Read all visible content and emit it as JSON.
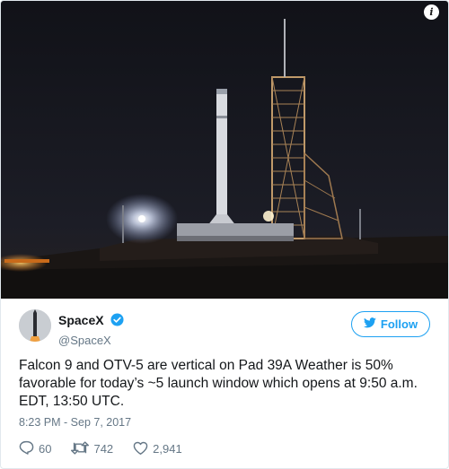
{
  "author": {
    "display_name": "SpaceX",
    "handle": "@SpaceX"
  },
  "follow_button": {
    "label": "Follow"
  },
  "tweet": {
    "text": "Falcon 9 and OTV-5 are vertical on Pad 39A Weather is 50% favorable for today’s ~5 launch window which opens at 9:50 a.m. EDT, 13:50 UTC.",
    "timestamp": "8:23 PM - Sep 7, 2017"
  },
  "stats": {
    "replies": "60",
    "retweets": "742",
    "likes": "2,941"
  },
  "icons": {
    "info": "info-icon",
    "verified": "verified-badge-icon",
    "bird": "twitter-bird-icon",
    "reply": "reply-icon",
    "retweet": "retweet-icon",
    "like": "heart-icon"
  },
  "colors": {
    "accent": "#1da1f2",
    "text": "#14171a",
    "muted": "#657786",
    "border": "#e1e8ed",
    "night_sky": "#15161d"
  }
}
